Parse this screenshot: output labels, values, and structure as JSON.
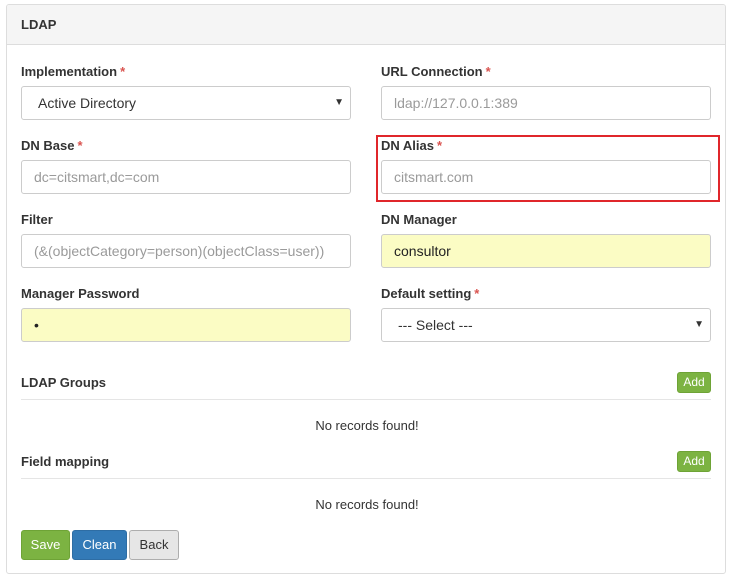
{
  "panel": {
    "title": "LDAP"
  },
  "required_marker": "*",
  "fields": {
    "implementation": {
      "label": "Implementation",
      "value": "Active Directory"
    },
    "url_connection": {
      "label": "URL Connection",
      "placeholder": "ldap://127.0.0.1:389"
    },
    "dn_base": {
      "label": "DN Base",
      "placeholder": "dc=citsmart,dc=com"
    },
    "dn_alias": {
      "label": "DN Alias",
      "placeholder": "citsmart.com"
    },
    "filter": {
      "label": "Filter",
      "placeholder": "(&(objectCategory=person)(objectClass=user))"
    },
    "dn_manager": {
      "label": "DN Manager",
      "value": "consultor"
    },
    "manager_password": {
      "label": "Manager Password",
      "value": "•"
    },
    "default_setting": {
      "label": "Default setting",
      "value": "--- Select ---"
    }
  },
  "sections": {
    "ldap_groups": {
      "title": "LDAP Groups",
      "add_label": "Add",
      "empty_text": "No records found!"
    },
    "field_mapping": {
      "title": "Field mapping",
      "add_label": "Add",
      "empty_text": "No records found!"
    }
  },
  "actions": {
    "save": "Save",
    "clean": "Clean",
    "back": "Back"
  },
  "icons": {
    "select_chevron": "chevron-down-icon"
  },
  "colors": {
    "required": "#d9534f",
    "autofill": "#fbfcc4",
    "highlight": "#e0262b",
    "save_button": "#7cb342",
    "clean_button": "#337ab7"
  }
}
